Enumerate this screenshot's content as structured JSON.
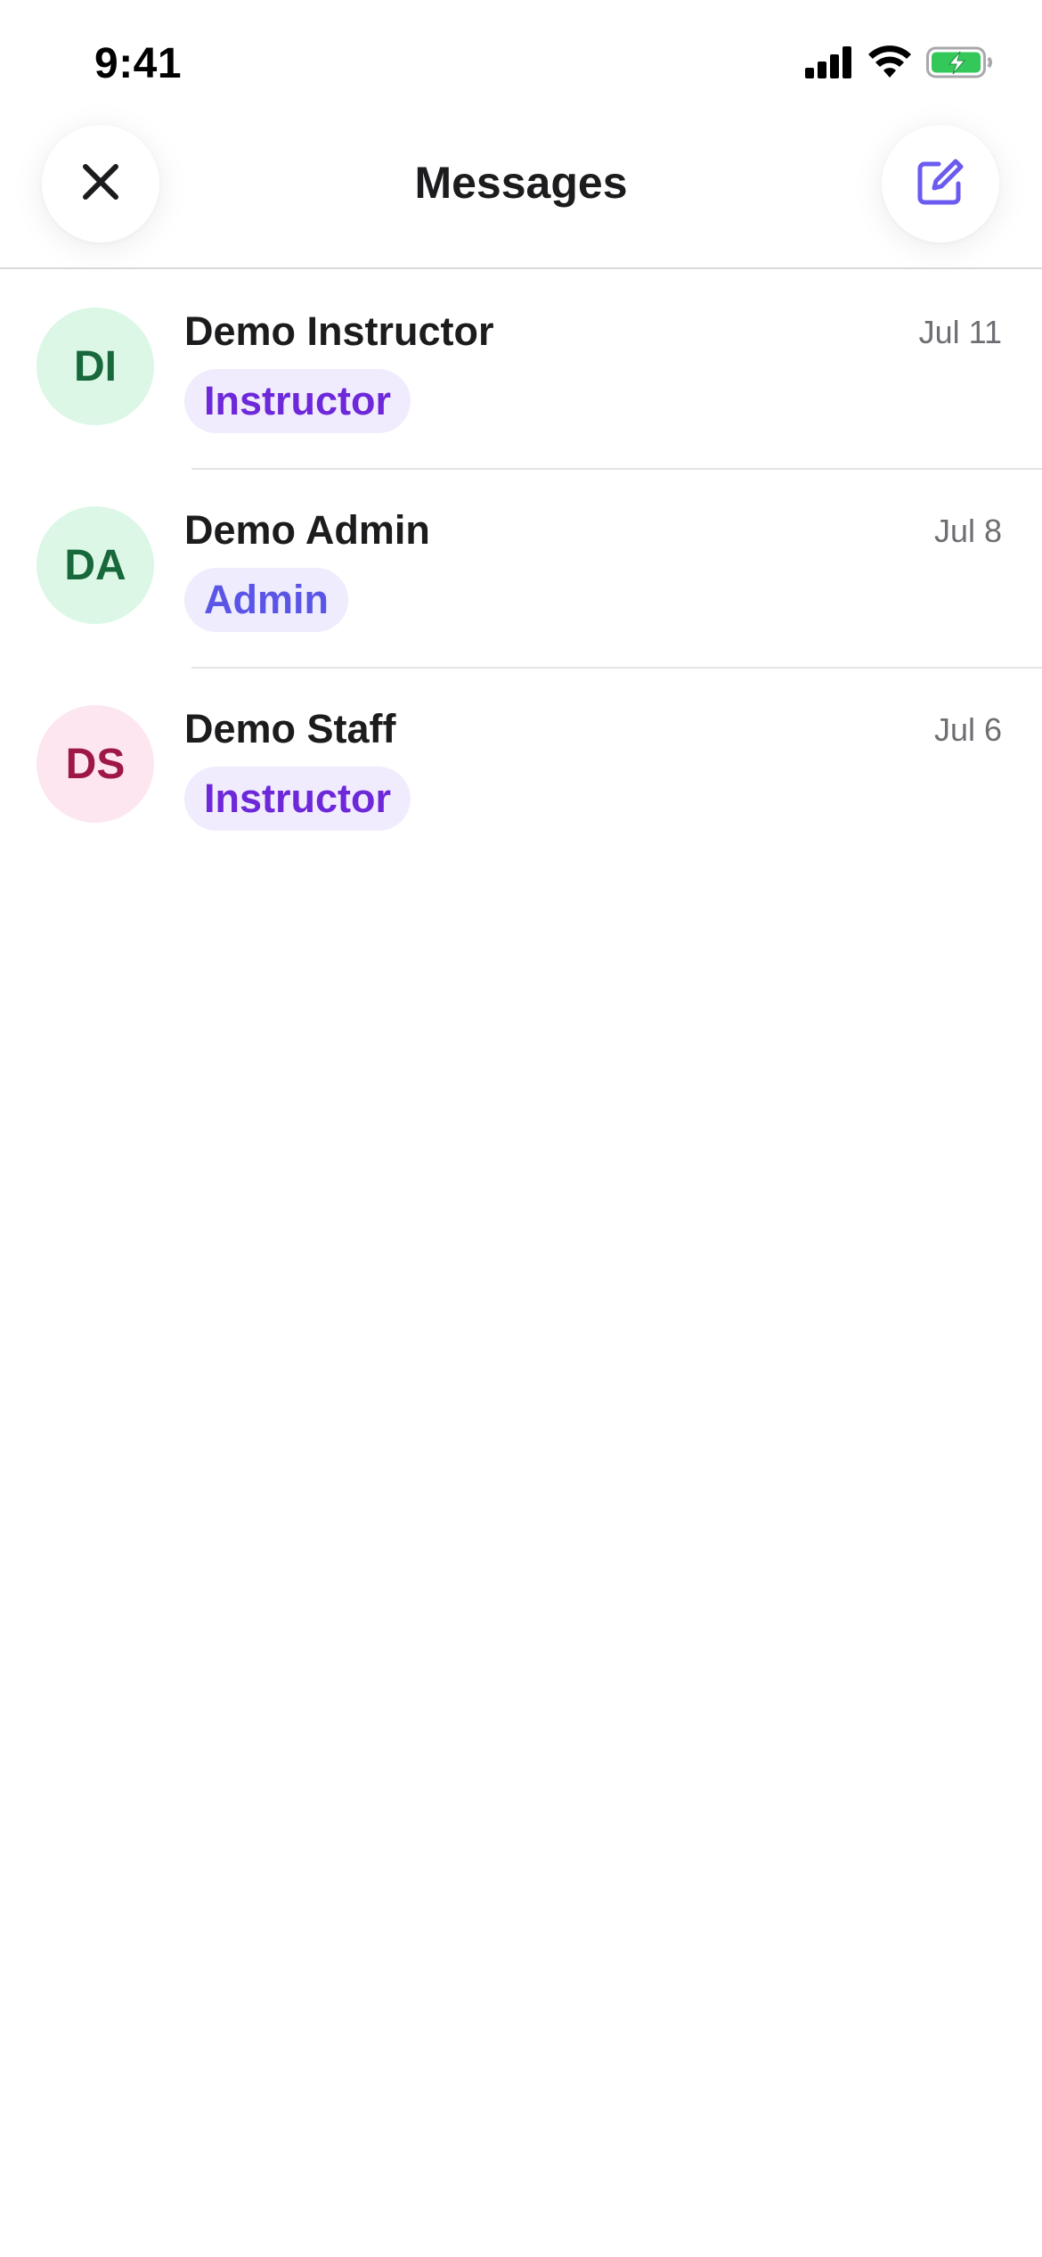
{
  "status_bar": {
    "time": "9:41",
    "icons": [
      "cellular-signal-icon",
      "wifi-icon",
      "battery-charging-icon"
    ]
  },
  "header": {
    "title": "Messages",
    "left_icon": "close-icon",
    "right_icon": "compose-icon"
  },
  "colors": {
    "accent": "#6b5bf0",
    "battery_green": "#34c759"
  },
  "conversations": [
    {
      "initials": "DI",
      "name": "Demo Instructor",
      "date": "Jul 11",
      "role": "Instructor",
      "avatar_bg": "#dcf7e6",
      "avatar_fg": "#17683a",
      "badge_bg": "#f1ecfd",
      "badge_fg": "#6d28d9"
    },
    {
      "initials": "DA",
      "name": "Demo Admin",
      "date": "Jul 8",
      "role": "Admin",
      "avatar_bg": "#dcf7e6",
      "avatar_fg": "#17683a",
      "badge_bg": "#eeecfd",
      "badge_fg": "#5b55e6"
    },
    {
      "initials": "DS",
      "name": "Demo Staff",
      "date": "Jul 6",
      "role": "Instructor",
      "avatar_bg": "#fde6ef",
      "avatar_fg": "#9d1747",
      "badge_bg": "#f1ecfd",
      "badge_fg": "#6d28d9"
    }
  ]
}
